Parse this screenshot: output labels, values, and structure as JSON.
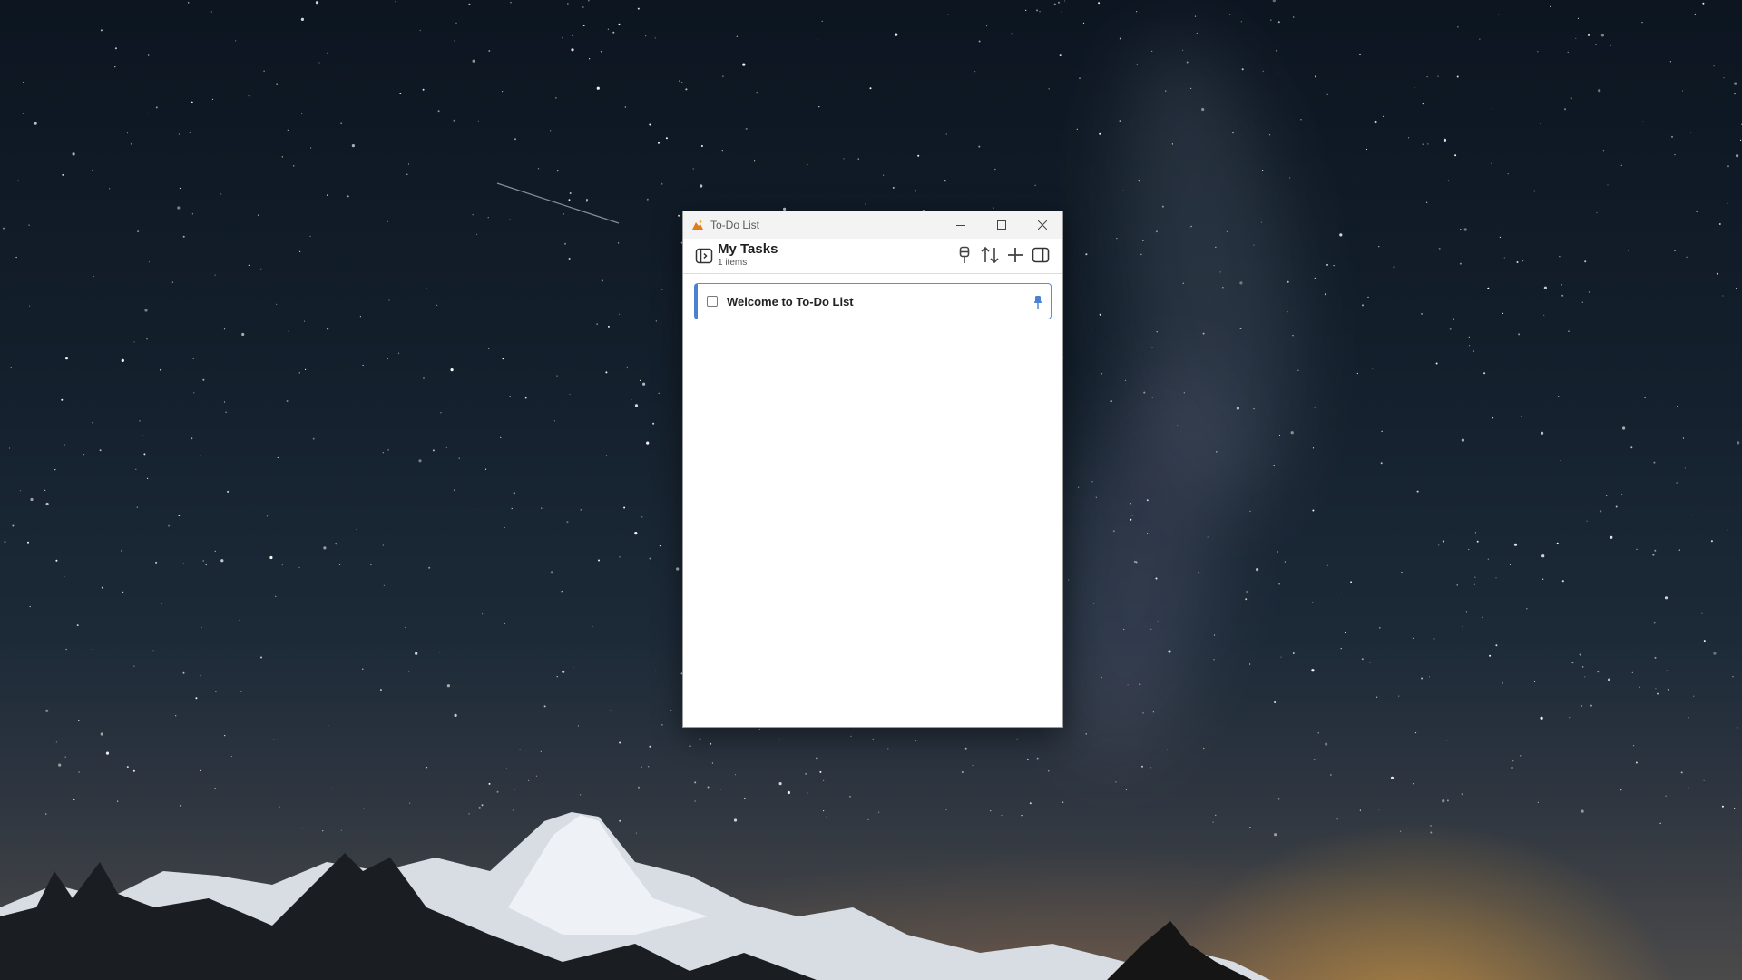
{
  "window": {
    "title": "To-Do List"
  },
  "header": {
    "title": "My Tasks",
    "count": "1 items"
  },
  "tasks": [
    {
      "text": "Welcome to To-Do List",
      "checked": false,
      "pinned": true
    }
  ],
  "icons": {
    "app": "app-icon",
    "sidebar_toggle": "sidebar-toggle-icon",
    "pin": "pin-icon",
    "sort": "sort-icon",
    "add": "plus-icon",
    "panel": "panel-icon",
    "minimize": "minimize-icon",
    "maximize": "maximize-icon",
    "close": "close-icon"
  },
  "colors": {
    "accent": "#4a82d0",
    "pin": "#4a82d0"
  }
}
